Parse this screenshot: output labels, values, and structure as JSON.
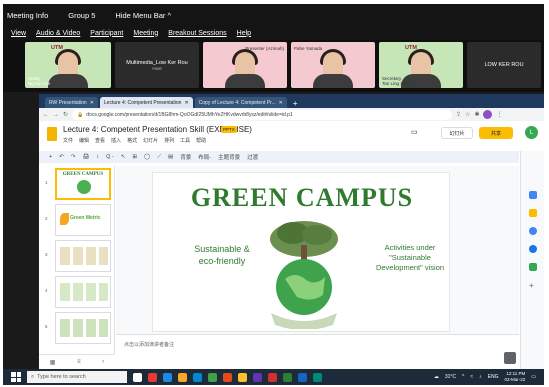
{
  "zoom": {
    "menubar": [
      "Meeting Info",
      "Group 5",
      "Hide Menu Bar ^"
    ],
    "app_menu": [
      "View",
      "Audio & Video",
      "Participant",
      "Meeting",
      "Breakout Sessions",
      "Help"
    ],
    "tiles": [
      {
        "label": "Hailey\nNg Sin Lee",
        "tag": "UTM"
      },
      {
        "label": "Multimedia_Low Ker Rou",
        "sub": "Host"
      },
      {
        "label": "Presenter (Azimah)",
        "tag": ""
      },
      {
        "label": "Pahe Yamada",
        "tag": ""
      },
      {
        "label": "Secretary\nTan Ling Xian",
        "tag": "UTM"
      },
      {
        "label": "LOW KER ROU"
      }
    ]
  },
  "browser": {
    "tabs": [
      {
        "label": "RW Presentation"
      },
      {
        "label": "Lecture 4: Competent Presentation"
      },
      {
        "label": "Copy of Lecture 4: Competent Pr..."
      }
    ],
    "new_tab": "+",
    "url": "docs.google.com/presentation/d/1BG8hm-QoOGdI25UMhYeZHKvdwvrb8ysz/edit#slide=id.p1"
  },
  "slides_app": {
    "title": "Lecture 4: Competent Presentation Skill (EXERCISE)",
    "badge": "PPTX",
    "menu": [
      "文件",
      "编辑",
      "查看",
      "插入",
      "格式",
      "幻灯片",
      "排列",
      "工具",
      "帮助"
    ],
    "present_label": "幻灯片",
    "share_label": "共享",
    "user_initial": "L",
    "toolbar": [
      "+",
      "↶",
      "↷",
      "🖨",
      "↕",
      "Q -",
      "↖",
      "⊞",
      "◯",
      "⟋",
      "▤",
      "背景",
      "布局-",
      "主题背景",
      "过渡"
    ],
    "slide_numbers": [
      "1",
      "2",
      "3",
      "4",
      "5"
    ],
    "thumb_titles": [
      "GREEN CAMPUS",
      "Green Metric",
      "",
      "",
      ""
    ],
    "notes_placeholder": "点击以添加演讲者备注"
  },
  "slide": {
    "title": "GREEN CAMPUS",
    "left_text": "Sustainable & eco-friendly",
    "right_text": "Activities under \"Sustainable Development\" vision"
  },
  "taskbar": {
    "search": "Type here to search",
    "temp": "31°C",
    "lang": "ENG",
    "time": "12:11 PM",
    "date": "03-Mar-22"
  },
  "colors": {
    "slide_green": "#2f7a2f",
    "share_yellow": "#fbbc04",
    "tabbar_blue": "#1f3a5e"
  }
}
